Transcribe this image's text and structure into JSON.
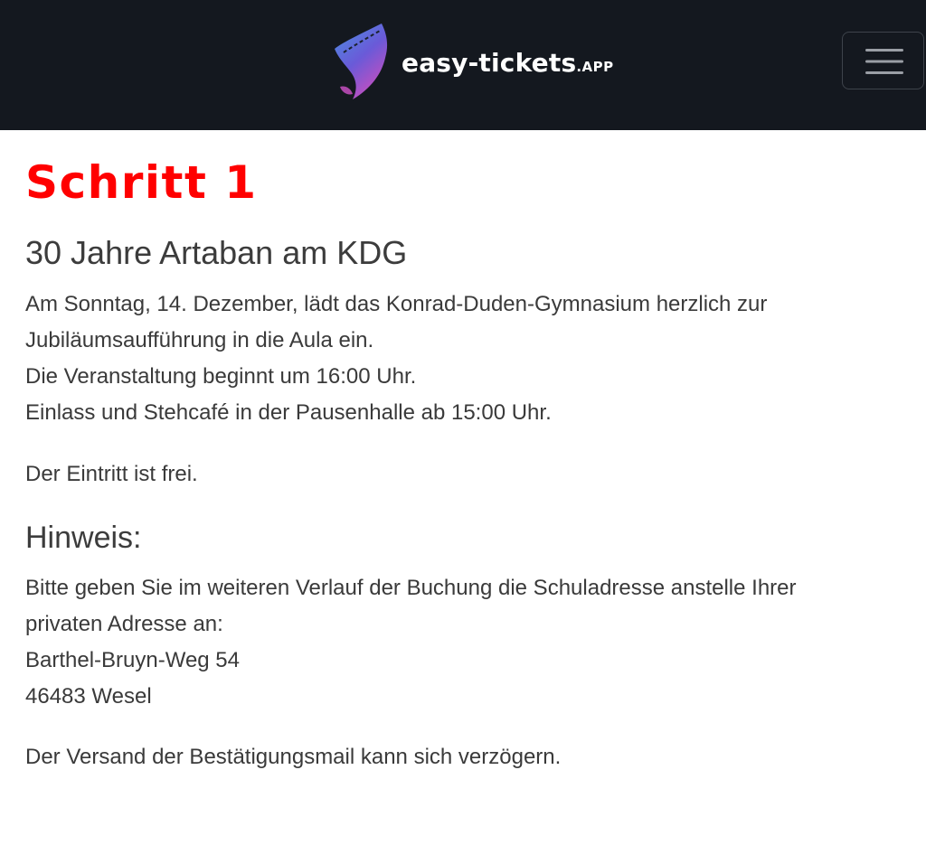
{
  "header": {
    "brand_name": "easy-tickets",
    "brand_tld": ".APP",
    "brand_colors": [
      "#4a90e2",
      "#7b4fd6",
      "#c44fc0"
    ],
    "menu_icon": "hamburger-icon"
  },
  "main": {
    "step_title": "Schritt 1",
    "event_title": "30 Jahre Artaban am KDG",
    "intro_lines": [
      "Am Sonntag, 14. Dezember, lädt das Konrad-Duden-Gymnasium herzlich zur",
      "Jubiläumsaufführung in die Aula ein.",
      "Die Veranstaltung beginnt um 16:00 Uhr.",
      "Einlass und Stehcafé in der Pausenhalle ab 15:00 Uhr."
    ],
    "admission": "Der Eintritt ist frei.",
    "hint_title": "Hinweis:",
    "hint_lines": [
      "Bitte geben Sie im weiteren Verlauf der Buchung die Schuladresse anstelle Ihrer",
      "privaten Adresse an:",
      "Barthel-Bruyn-Weg 54",
      "46483 Wesel"
    ],
    "mail_note": "Der Versand der Bestätigungsmail kann sich verzögern."
  },
  "colors": {
    "navbar_bg": "#14181f",
    "step_title": "#ff0000",
    "body_text": "#3a3a3a"
  }
}
